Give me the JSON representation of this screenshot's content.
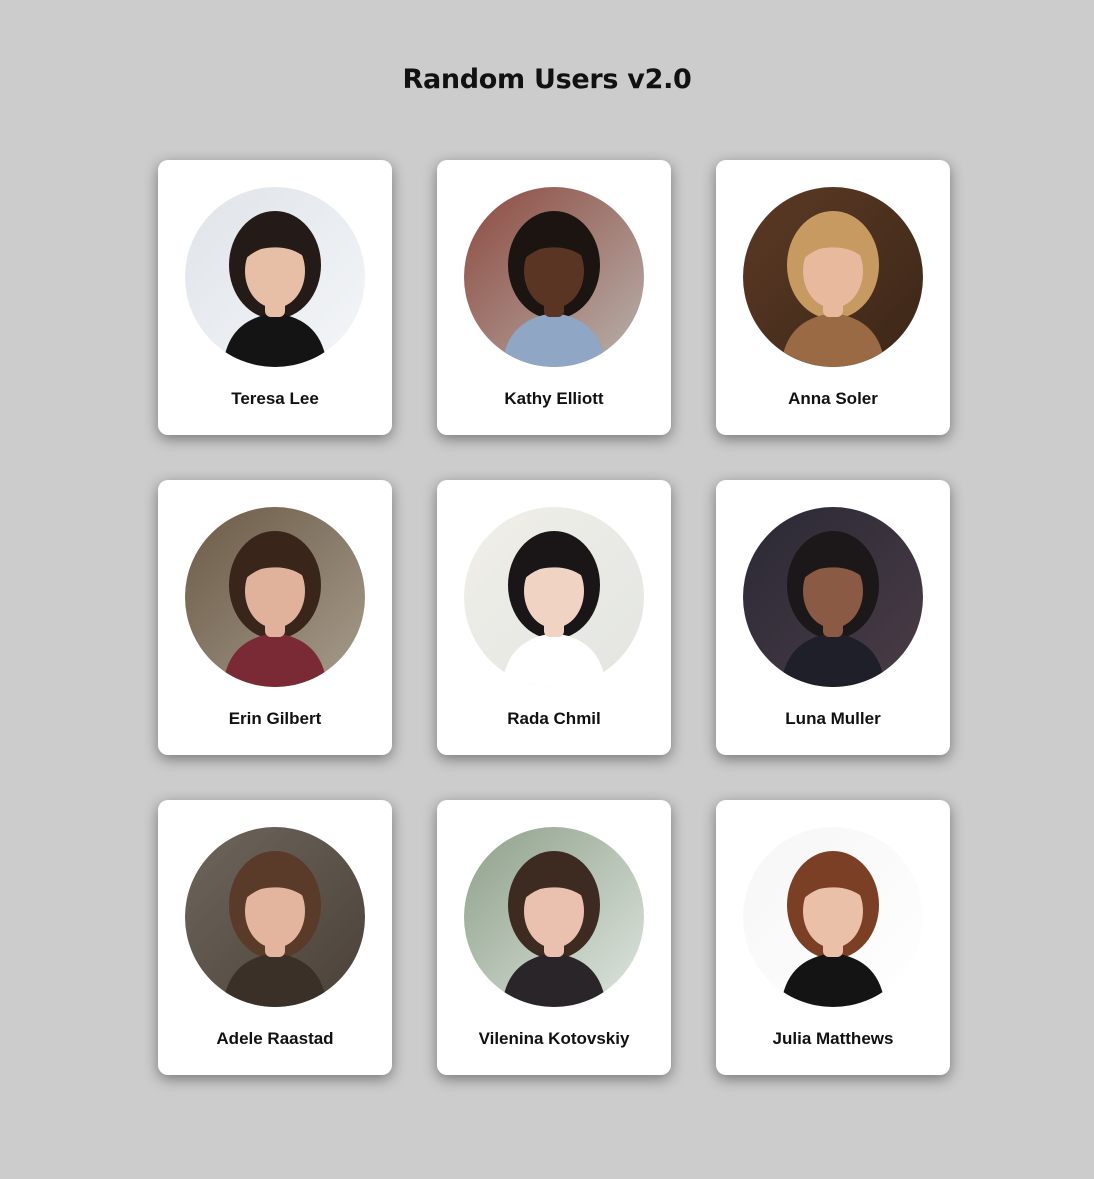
{
  "page": {
    "title": "Random Users v2.0"
  },
  "users": [
    {
      "name": "Teresa Lee",
      "bg": "#dfe4ea",
      "bg2": "#f4f6f8",
      "skin": "#e7bfa6",
      "hair": "#241a17",
      "shirt": "#141414"
    },
    {
      "name": "Kathy Elliott",
      "bg": "#8c4a3f",
      "bg2": "#b9b2ad",
      "skin": "#5a3523",
      "hair": "#1b1411",
      "shirt": "#8fa6c4"
    },
    {
      "name": "Anna Soler",
      "bg": "#5c3a24",
      "bg2": "#3b2618",
      "skin": "#e8b99c",
      "hair": "#c79a62",
      "shirt": "#9a6a45"
    },
    {
      "name": "Erin Gilbert",
      "bg": "#6b5a47",
      "bg2": "#a79c8c",
      "skin": "#e0b29c",
      "hair": "#3a251b",
      "shirt": "#7a2a34"
    },
    {
      "name": "Rada Chmil",
      "bg": "#f0efe9",
      "bg2": "#e3e5e1",
      "skin": "#f0d3c2",
      "hair": "#1a1617",
      "shirt": "#ffffff"
    },
    {
      "name": "Luna Muller",
      "bg": "#2a2935",
      "bg2": "#4a3c46",
      "skin": "#8a5a45",
      "hair": "#1c1718",
      "shirt": "#1f1f29"
    },
    {
      "name": "Adele Raastad",
      "bg": "#6e665c",
      "bg2": "#4a4038",
      "skin": "#e3b59f",
      "hair": "#5a3a28",
      "shirt": "#3a3028"
    },
    {
      "name": "Vilenina Kotovskiy",
      "bg": "#8ea08a",
      "bg2": "#dfe6e0",
      "skin": "#e9c1ae",
      "hair": "#3d2a20",
      "shirt": "#2a2528"
    },
    {
      "name": "Julia Matthews",
      "bg": "#f6f6f6",
      "bg2": "#ffffff",
      "skin": "#eac1a8",
      "hair": "#7a3f24",
      "shirt": "#141414"
    }
  ]
}
